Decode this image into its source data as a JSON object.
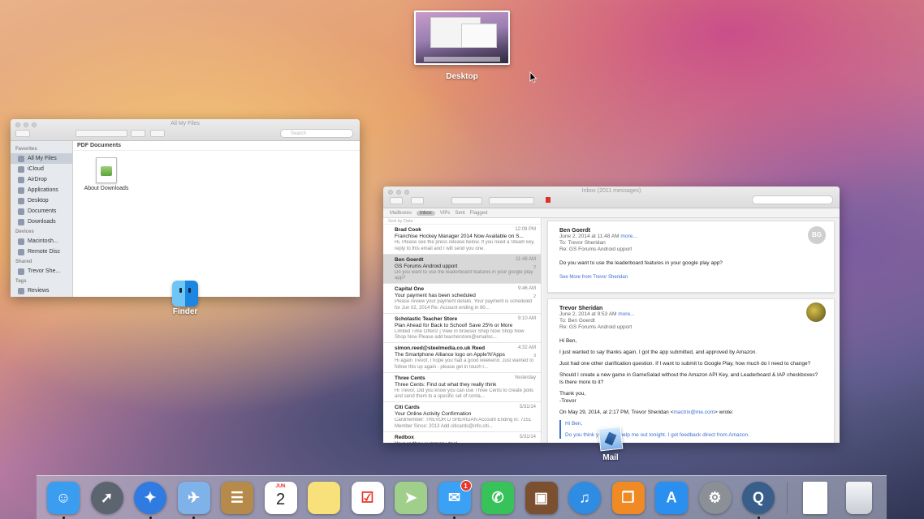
{
  "desktop": {
    "label": "Desktop"
  },
  "finder": {
    "window_title": "All My Files",
    "search_placeholder": "Search",
    "sidebar_sections": [
      {
        "heading": "Favorites",
        "items": [
          "All My Files",
          "iCloud",
          "AirDrop",
          "Applications",
          "Desktop",
          "Documents",
          "Downloads"
        ]
      },
      {
        "heading": "Devices",
        "items": [
          "Macintosh...",
          "Remote Disc"
        ]
      },
      {
        "heading": "Shared",
        "items": [
          "Trevor She..."
        ]
      },
      {
        "heading": "Tags",
        "items": [
          "Reviews"
        ]
      }
    ],
    "section_title": "PDF Documents",
    "file_name": "About Downloads",
    "app_label": "Finder"
  },
  "mail": {
    "window_title": "Inbox (2011 messages)",
    "favorites": [
      "Mailboxes",
      "Inbox",
      "VIPs",
      "Sent",
      "Flagged"
    ],
    "sort_label": "Sort by Date",
    "messages": [
      {
        "from": "Brad Cook",
        "time": "12:09 PM",
        "subject": "Franchise Hockey Manager 2014 Now Available on S...",
        "preview": "Hi, Please see the press release below. If you need a Steam key, reply to this email and I will send you one.",
        "count": ""
      },
      {
        "from": "Ben Goerdt",
        "time": "11:48 AM",
        "subject": "GS Forums Android upport",
        "preview": "Do you want to use the leaderboard features in your google play app?",
        "count": "2"
      },
      {
        "from": "Capital One",
        "time": "9:46 AM",
        "subject": "Your payment has been scheduled",
        "preview": "Please review your payment details. Your payment is scheduled for Jun 02, 2014 Re: Account ending in 60...",
        "count": "2"
      },
      {
        "from": "Scholastic Teacher Store",
        "time": "9:10 AM",
        "subject": "Plan Ahead for Back to School! Save 25% or More",
        "preview": "Limited Time Offers! | View in browser Shop Now Shop Now Shop Now Please add teacherstore@emailsc...",
        "count": ""
      },
      {
        "from": "simon.reed@steelmedia.co.uk Reed",
        "time": "4:32 AM",
        "subject": "The Smartphone Alliance logo on Apple'N'Apps",
        "preview": "Hi again Trevor, I hope you had a good weekend. Just wanted to follow this up again - please get in touch r...",
        "count": "3"
      },
      {
        "from": "Three Cents",
        "time": "Yesterday",
        "subject": "Three Cents: Find out what they really think",
        "preview": "Hi Trevor, Did you know you can use Three Cents to create polls and send them to a specific set of conta...",
        "count": ""
      },
      {
        "from": "Citi Cards",
        "time": "5/31/14",
        "subject": "Your Online Activity Confirmation",
        "preview": "Cardmember: TREVOR D SHERIDAN Account Ending in: 7251 Member Since: 2013 Add citicards@info.citi...",
        "count": ""
      },
      {
        "from": "Redbox",
        "time": "5/31/14",
        "subject": "Your redbox summary deal",
        "preview": "",
        "count": ""
      }
    ],
    "thread": [
      {
        "from": "Ben Goerdt",
        "date": "June 2, 2014 at 11:48 AM",
        "more": "more...",
        "to": "To:  Trevor Sheridan",
        "re": "Re: GS Forums Android upport",
        "initials": "BG",
        "body": [
          "Do you want to use the leaderboard features in your google play app?"
        ],
        "see_more": "See More from Trevor Sheridan"
      },
      {
        "from": "Trevor Sheridan",
        "date": "June 2, 2014 at 9:53 AM",
        "more": "more...",
        "to": "To:  Ben Goerdt",
        "re": "Re: GS Forums Android upport",
        "body": [
          "Hi Ben,",
          "I just wanted to say thanks again. I got the app submitted, and approved by Amazon.",
          "Just had one other clarification question. If I want to submit to Google Play, how much do I need to change?",
          "Should I create a new game in GameSalad without the Amazon API Key, and Leaderboard & IAP checkboxes? Is there more to it?",
          "Thank you,",
          "-Trevor"
        ],
        "wrote_prefix": "On May 29, 2014, at 2:17 PM, Trevor Sheridan <",
        "wrote_email": "mactrix@me.com",
        "wrote_suffix": "> wrote:",
        "quote": [
          "Hi Ben,",
          "Do you think you could help me out tonight. I got feedback direct from Amazon."
        ]
      }
    ],
    "app_label": "Mail"
  },
  "dock": {
    "apps": [
      {
        "name": "finder",
        "running": true
      },
      {
        "name": "launchpad",
        "running": false
      },
      {
        "name": "safari",
        "running": true
      },
      {
        "name": "mail",
        "running": true
      },
      {
        "name": "contacts",
        "running": false
      },
      {
        "name": "calendar",
        "running": false,
        "month": "JUN",
        "day": "2"
      },
      {
        "name": "notes",
        "running": false
      },
      {
        "name": "reminders",
        "running": false
      },
      {
        "name": "maps",
        "running": false
      },
      {
        "name": "messages",
        "running": true,
        "badge": "1"
      },
      {
        "name": "facetime",
        "running": false
      },
      {
        "name": "photo-booth",
        "running": false
      },
      {
        "name": "itunes",
        "running": false
      },
      {
        "name": "ibooks",
        "running": false
      },
      {
        "name": "app-store",
        "running": false
      },
      {
        "name": "system-preferences",
        "running": false
      },
      {
        "name": "quicktime",
        "running": true
      }
    ],
    "colors": {
      "finder": "#3a9df0",
      "launchpad": "#5c6470",
      "safari": "#2f7be2",
      "mail": "#7fb2e8",
      "contacts": "#b58a4a",
      "calendar": "#ffffff",
      "notes": "#f8e07a",
      "reminders": "#ffffff",
      "maps": "#9fcf8a",
      "messages": "#3aa1f5",
      "facetime": "#38c25a",
      "photo-booth": "#7a5030",
      "itunes": "#2e8ce3",
      "ibooks": "#f08a24",
      "app-store": "#2b8ff0",
      "system-preferences": "#8b8f96",
      "quicktime": "#3a5e8a"
    }
  }
}
